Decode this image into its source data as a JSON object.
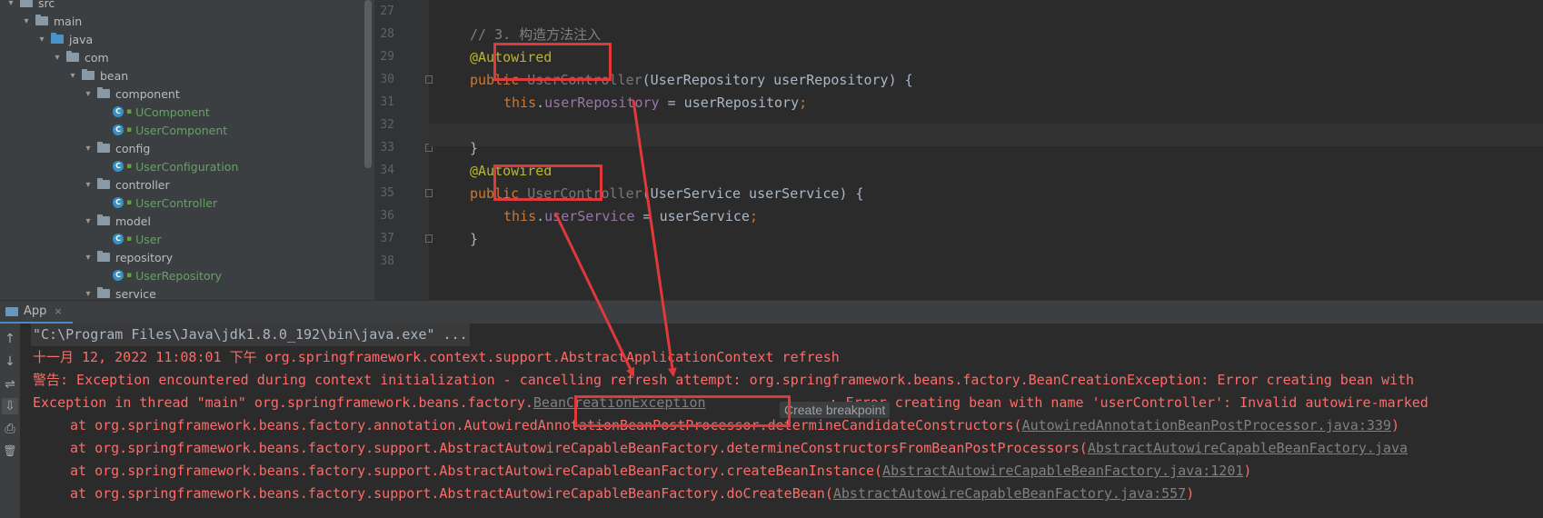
{
  "project_tree": {
    "items": [
      {
        "label": "src",
        "type": "folder",
        "indent": 0,
        "expanded": true
      },
      {
        "label": "main",
        "type": "folder",
        "indent": 1,
        "expanded": true
      },
      {
        "label": "java",
        "type": "source-folder",
        "indent": 2,
        "expanded": true
      },
      {
        "label": "com",
        "type": "package",
        "indent": 3,
        "expanded": true
      },
      {
        "label": "bean",
        "type": "package",
        "indent": 4,
        "expanded": true
      },
      {
        "label": "component",
        "type": "package",
        "indent": 5,
        "expanded": true
      },
      {
        "label": "UComponent",
        "type": "class",
        "indent": 6
      },
      {
        "label": "UserComponent",
        "type": "class",
        "indent": 6
      },
      {
        "label": "config",
        "type": "package",
        "indent": 5,
        "expanded": true
      },
      {
        "label": "UserConfiguration",
        "type": "class",
        "indent": 6
      },
      {
        "label": "controller",
        "type": "package",
        "indent": 5,
        "expanded": true
      },
      {
        "label": "UserController",
        "type": "class",
        "indent": 6
      },
      {
        "label": "model",
        "type": "package",
        "indent": 5,
        "expanded": true
      },
      {
        "label": "User",
        "type": "class",
        "indent": 6
      },
      {
        "label": "repository",
        "type": "package",
        "indent": 5,
        "expanded": true
      },
      {
        "label": "UserRepository",
        "type": "class",
        "indent": 6
      },
      {
        "label": "service",
        "type": "package",
        "indent": 5,
        "expanded": true
      }
    ]
  },
  "editor": {
    "line_numbers": [
      "27",
      "28",
      "29",
      "30",
      "31",
      "32",
      "33",
      "34",
      "35",
      "36",
      "37",
      "38"
    ],
    "code": {
      "l28_comment": "// 3. 构造方法注入",
      "l29_ann": "@Autowired",
      "l30_kw": "public",
      "l30_name": " UserController",
      "l30_rest": "(UserRepository userRepository) {",
      "l31_this": "this",
      "l31_dot": ".",
      "l31_field": "userRepository",
      "l31_rest": " = userRepository",
      "l31_semi": ";",
      "l33": "}",
      "l34_ann": "@Autowired",
      "l35_kw": "public",
      "l35_name": " UserController",
      "l35_rest": "(UserService userService) {",
      "l36_this": "this",
      "l36_dot": ".",
      "l36_field": "userService",
      "l36_rest": " = userService",
      "l36_semi": ";",
      "l37": "}"
    }
  },
  "run_panel": {
    "tab_label": "App",
    "close_glyph": "×",
    "side_icons": [
      "↑",
      "↓",
      "⇌",
      "⇩",
      "⎙",
      "🗑"
    ],
    "console": {
      "cmd": "\"C:\\Program Files\\Java\\jdk1.8.0_192\\bin\\java.exe\" ...",
      "line1": "十一月 12, 2022 11:08:01 下午 org.springframework.context.support.AbstractApplicationContext refresh",
      "line2": "警告: Exception encountered during context initialization - cancelling refresh attempt: org.springframework.beans.factory.BeanCreationException: Error creating bean with",
      "line3_pre": "Exception in thread \"main\" org.springframework.beans.factory.",
      "line3_link": "BeanCreationException",
      "line3_post": ": Error creating bean with name 'userController': Invalid autowire-marked",
      "tooltip": "Create breakpoint",
      "st1_pre": "at org.springframework.beans.factory.annotation.AutowiredAnnotationBeanPostProcessor.determineCandidateConstructors(",
      "st1_link": "AutowiredAnnotationBeanPostProcessor.java:339",
      "st1_post": ")",
      "st2_pre": "at org.springframework.beans.factory.support.AbstractAutowireCapableBeanFactory.determineConstructorsFromBeanPostProcessors(",
      "st2_link": "AbstractAutowireCapableBeanFactory.java",
      "st3_pre": "at org.springframework.beans.factory.support.AbstractAutowireCapableBeanFactory.createBeanInstance(",
      "st3_link": "AbstractAutowireCapableBeanFactory.java:1201",
      "st3_post": ")",
      "st4_pre": "at org.springframework.beans.factory.support.AbstractAutowireCapableBeanFactory.doCreateBean(",
      "st4_link": "AbstractAutowireCapableBeanFactory.java:557",
      "st4_post": ")"
    }
  },
  "colors": {
    "annotation_red": "#e0383b",
    "error_text": "#ff6b68",
    "keyword": "#cc7832",
    "annotation": "#bbb529",
    "field": "#9876aa"
  }
}
